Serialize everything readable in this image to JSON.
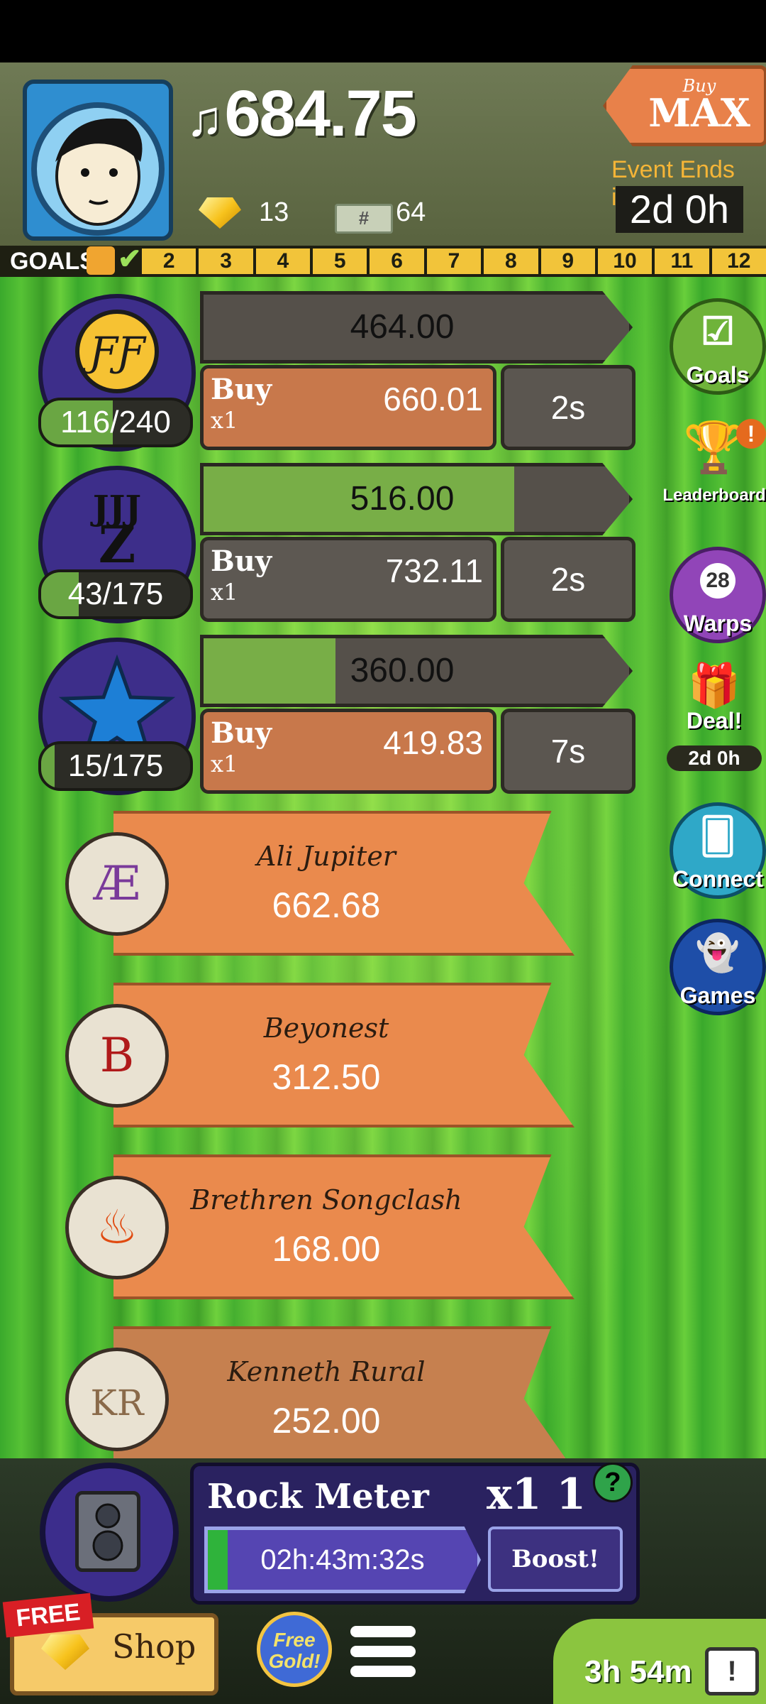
{
  "header": {
    "money": "684.75",
    "music_icon": "♫",
    "gems": "13",
    "cash_label": "#",
    "cash": "64",
    "buy_small": "Buy",
    "buy_big": "MAX",
    "event_label": "Event Ends in:",
    "event_time": "2d 0h"
  },
  "goals": {
    "label": "GOALS",
    "steps": [
      "2",
      "3",
      "4",
      "5",
      "6",
      "7",
      "8",
      "9",
      "10",
      "11",
      "12"
    ]
  },
  "venues": [
    {
      "icon": "ƑƑ",
      "count": "116/240",
      "count_fill": 0.48,
      "progress_value": "464.00",
      "progress_fill": 0.0,
      "buy": "Buy",
      "mult": "x1",
      "price": "660.01",
      "time": "2s",
      "buy_style": "orange"
    },
    {
      "icon": "JJJ Z",
      "count": "43/175",
      "count_fill": 0.25,
      "progress_value": "516.00",
      "progress_fill": 0.73,
      "buy": "Buy",
      "mult": "x1",
      "price": "732.11",
      "time": "2s",
      "buy_style": "grey"
    },
    {
      "icon": "★",
      "count": "15/175",
      "count_fill": 0.09,
      "progress_value": "360.00",
      "progress_fill": 0.31,
      "buy": "Buy",
      "mult": "x1",
      "price": "419.83",
      "time": "7s",
      "buy_style": "orange"
    }
  ],
  "artists": [
    {
      "name": "Ali Jupiter",
      "amount": "662.68",
      "badge": "Æ",
      "badge_color": "#7a3a9a"
    },
    {
      "name": "Beyonest",
      "amount": "312.50",
      "badge": "B",
      "badge_color": "#b01a1a"
    },
    {
      "name": "Brethren Songclash",
      "amount": "168.00",
      "badge": "♨",
      "badge_color": "#e04a10"
    },
    {
      "name": "Kenneth Rural",
      "amount": "252.00",
      "badge": "KR",
      "badge_color": "#8a6a4a"
    }
  ],
  "side": {
    "goals": "Goals",
    "leaderboard": "Leaderboard",
    "leaderboard_alert": "!",
    "warps_count": "28",
    "warps": "Warps",
    "deal": "Deal!",
    "deal_time": "2d 0h",
    "connect": "Connect",
    "games": "Games"
  },
  "rock": {
    "title": "Rock Meter",
    "multiplier": "x1 1",
    "help": "?",
    "timer": "02h:43m:32s",
    "boost": "Boost!"
  },
  "bottom": {
    "free_tag": "FREE",
    "shop": "Shop",
    "free_gold": "Free Gold!",
    "tv_time": "3h 54m",
    "tv_alert": "!"
  }
}
